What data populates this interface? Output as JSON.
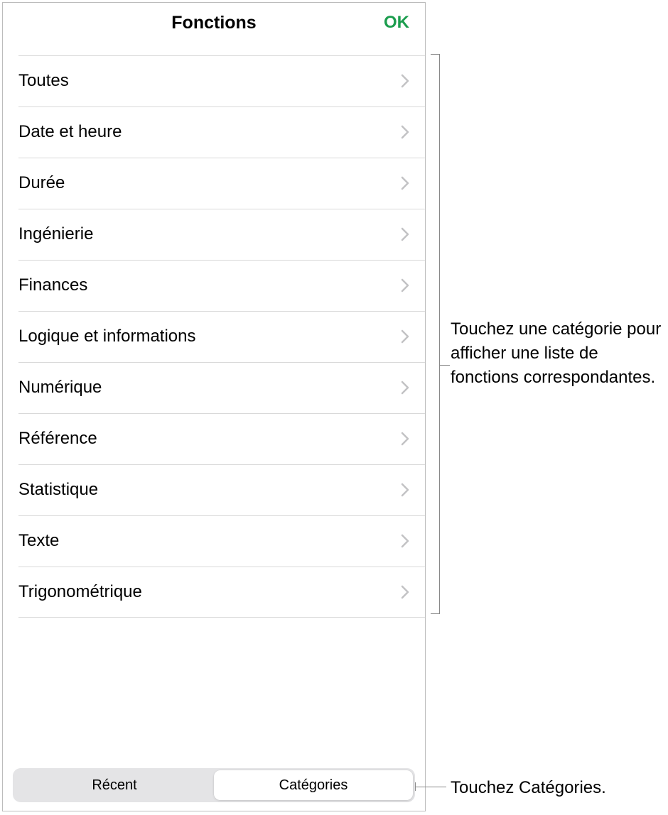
{
  "header": {
    "title": "Fonctions",
    "ok_label": "OK"
  },
  "categories": [
    {
      "label": "Toutes"
    },
    {
      "label": "Date et heure"
    },
    {
      "label": "Durée"
    },
    {
      "label": "Ingénierie"
    },
    {
      "label": "Finances"
    },
    {
      "label": "Logique et informations"
    },
    {
      "label": "Numérique"
    },
    {
      "label": "Référence"
    },
    {
      "label": "Statistique"
    },
    {
      "label": "Texte"
    },
    {
      "label": "Trigonométrique"
    }
  ],
  "tabs": {
    "recent": "Récent",
    "categories": "Catégories"
  },
  "callouts": {
    "list": "Touchez une catégorie pour afficher une liste de fonctions correspondantes.",
    "tab": "Touchez Catégories."
  }
}
